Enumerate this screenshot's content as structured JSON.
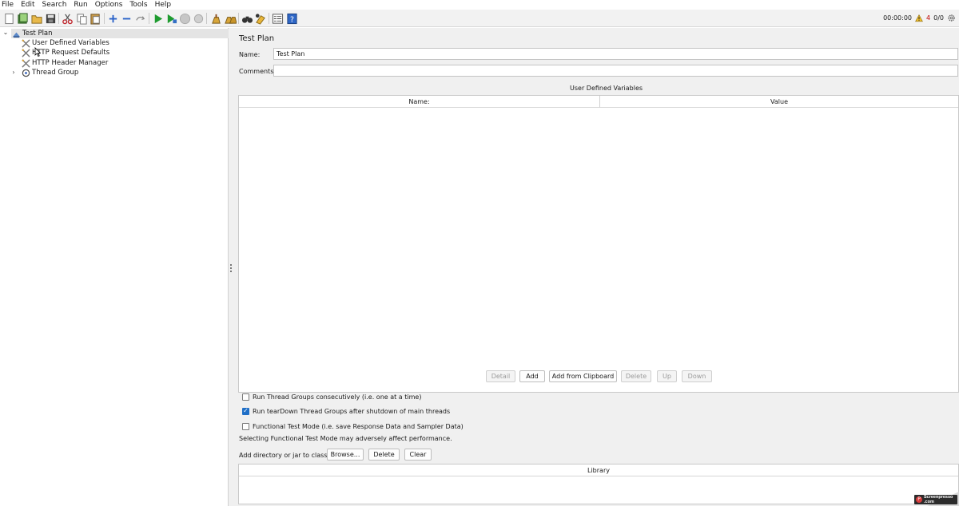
{
  "menubar": {
    "items": [
      {
        "label": "File"
      },
      {
        "label": "Edit"
      },
      {
        "label": "Search"
      },
      {
        "label": "Run"
      },
      {
        "label": "Options"
      },
      {
        "label": "Tools"
      },
      {
        "label": "Help"
      }
    ]
  },
  "toolbar": {
    "elapsed_time": "00:00:00",
    "warning_count": "4",
    "thread_count": "0/0"
  },
  "tree": {
    "root": {
      "label": "Test Plan"
    },
    "children": [
      {
        "label": "User Defined Variables"
      },
      {
        "label": "HTTP Request Defaults"
      },
      {
        "label": "HTTP Header Manager"
      },
      {
        "label": "Thread Group"
      }
    ]
  },
  "test_plan": {
    "title": "Test Plan",
    "name_label": "Name:",
    "name_value": "Test Plan",
    "comments_label": "Comments:",
    "comments_value": "",
    "udv_title": "User Defined Variables",
    "udv_columns": {
      "name": "Name:",
      "value": "Value"
    },
    "buttons": {
      "detail": "Detail",
      "add": "Add",
      "add_from_clipboard": "Add from Clipboard",
      "delete": "Delete",
      "up": "Up",
      "down": "Down"
    },
    "options": {
      "run_consecutively": {
        "label": "Run Thread Groups consecutively (i.e. one at a time)",
        "checked": false
      },
      "run_teardown": {
        "label": "Run tearDown Thread Groups after shutdown of main threads",
        "checked": true
      },
      "functional_mode": {
        "label": "Functional Test Mode (i.e. save Response Data and Sampler Data)",
        "checked": false
      }
    },
    "functional_note": "Selecting Functional Test Mode may adversely affect performance.",
    "classpath_label": "Add directory or jar to classpath",
    "classpath_buttons": {
      "browse": "Browse...",
      "delete": "Delete",
      "clear": "Clear"
    },
    "library_column": "Library"
  },
  "watermark": {
    "brand": "Screenpresso",
    "suffix": ".com"
  }
}
